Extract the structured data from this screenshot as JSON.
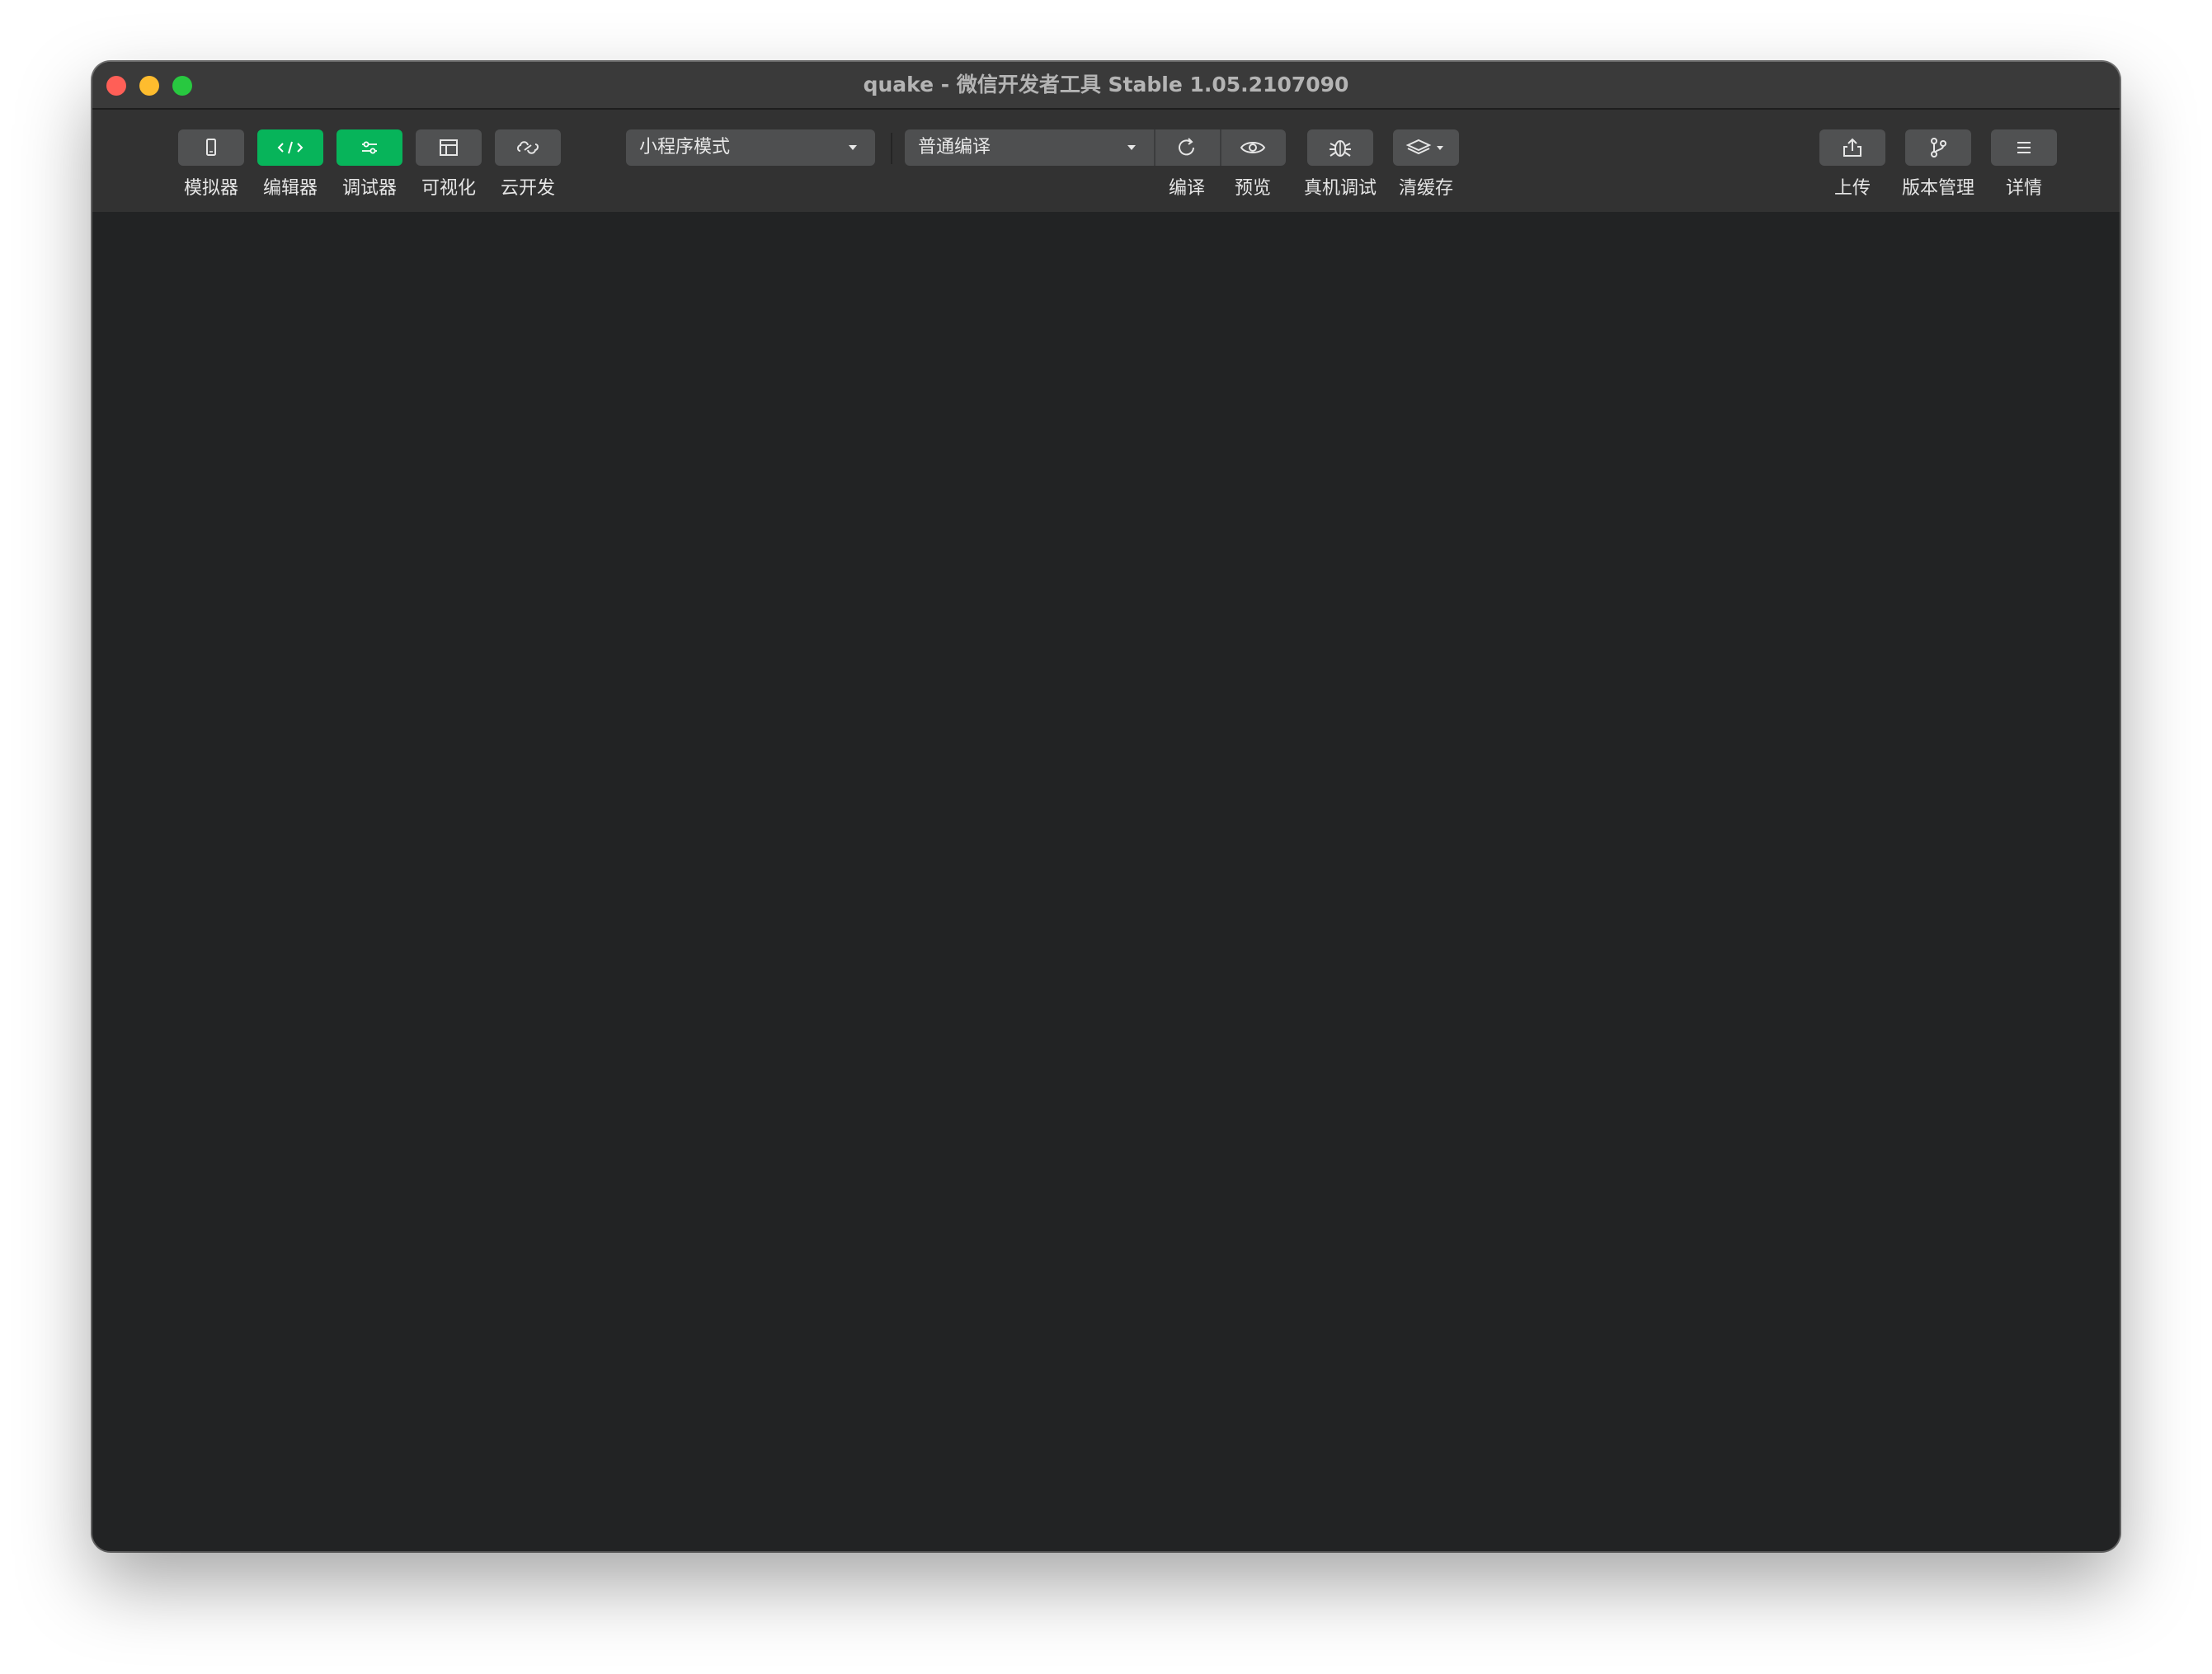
{
  "window": {
    "title": "quake - 微信开发者工具 Stable 1.05.2107090"
  },
  "toolbar": {
    "left_tools": [
      {
        "label": "模拟器",
        "icon": "phone-icon",
        "active": false
      },
      {
        "label": "编辑器",
        "icon": "code-icon",
        "active": true
      },
      {
        "label": "调试器",
        "icon": "sliders-icon",
        "active": true
      },
      {
        "label": "可视化",
        "icon": "layout-icon",
        "active": false
      },
      {
        "label": "云开发",
        "icon": "cloud-link-icon",
        "active": false
      }
    ],
    "mode_select": {
      "value": "小程序模式"
    },
    "compile_select": {
      "value": "普通编译"
    },
    "compile_actions": [
      {
        "label": "编译",
        "icon": "refresh-icon"
      },
      {
        "label": "预览",
        "icon": "eye-icon"
      },
      {
        "label": "真机调试",
        "icon": "bug-icon"
      },
      {
        "label": "清缓存",
        "icon": "layers-icon"
      }
    ],
    "right_tools": [
      {
        "label": "上传",
        "icon": "upload-icon"
      },
      {
        "label": "版本管理",
        "icon": "branch-icon"
      },
      {
        "label": "详情",
        "icon": "menu-icon"
      }
    ]
  },
  "colors": {
    "active": "#07b45a",
    "button": "#505152",
    "toolbar": "#323232",
    "content": "#222324"
  }
}
